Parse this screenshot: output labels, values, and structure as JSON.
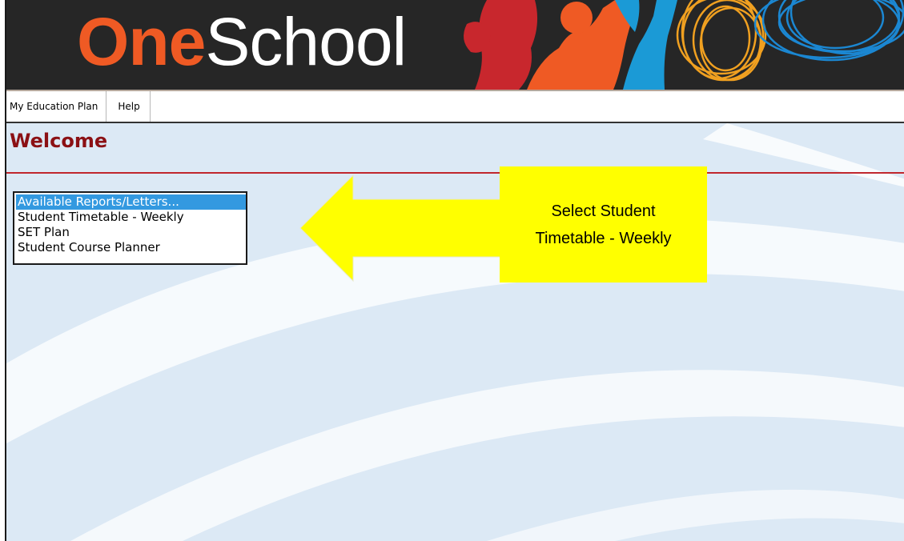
{
  "banner": {
    "logo_part1": "One",
    "logo_part2": "School"
  },
  "menu": {
    "items": [
      {
        "label": "My Education Plan"
      },
      {
        "label": "Help"
      }
    ]
  },
  "main": {
    "title": "Welcome",
    "report_list": {
      "options": [
        {
          "label": "Available Reports/Letters...",
          "selected": true
        },
        {
          "label": "Student Timetable - Weekly",
          "selected": false
        },
        {
          "label": "SET Plan",
          "selected": false
        },
        {
          "label": "Student Course Planner",
          "selected": false
        }
      ]
    }
  },
  "annotation": {
    "callout_text": "Select Student Timetable - Weekly",
    "arrow_color": "#ffff00"
  },
  "colors": {
    "title": "#8b1014",
    "rule": "#c0272d",
    "logo_accent": "#ef5a24",
    "selection": "#3399e0",
    "content_bg": "#dce9f5"
  }
}
